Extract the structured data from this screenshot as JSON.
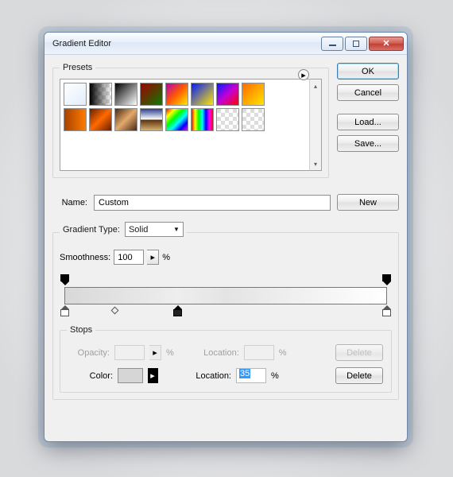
{
  "window": {
    "title": "Gradient Editor"
  },
  "buttons": {
    "ok": "OK",
    "cancel": "Cancel",
    "load": "Load...",
    "save": "Save...",
    "new": "New",
    "delete": "Delete"
  },
  "presets": {
    "legend": "Presets"
  },
  "name": {
    "label": "Name:",
    "value": "Custom"
  },
  "gradient_type": {
    "label": "Gradient Type:",
    "value": "Solid"
  },
  "smoothness": {
    "label": "Smoothness:",
    "value": "100",
    "unit": "%"
  },
  "stops": {
    "legend": "Stops",
    "opacity_label": "Opacity:",
    "opacity_value": "",
    "opacity_unit": "%",
    "location_label": "Location:",
    "location1_value": "",
    "location1_unit": "%",
    "color_label": "Color:",
    "location2_value": "35",
    "location2_unit": "%"
  }
}
